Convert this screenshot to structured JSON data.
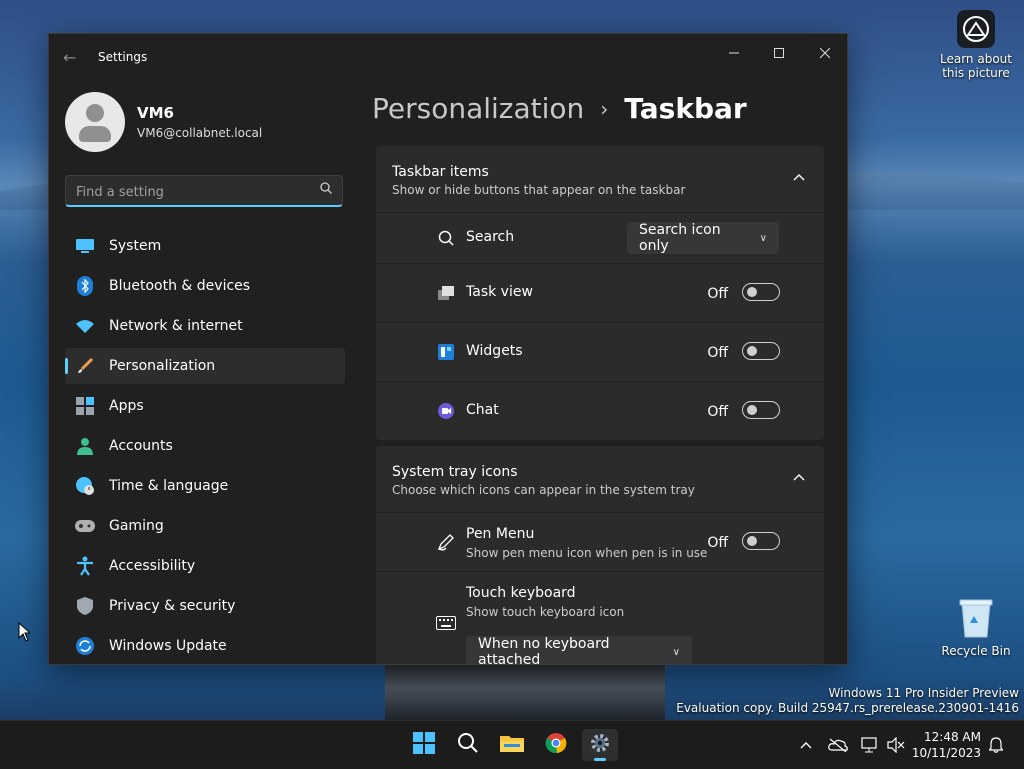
{
  "desktop": {
    "learn_label": "Learn about this picture",
    "recycle_label": "Recycle Bin",
    "watermark_line1": "Windows 11 Pro Insider Preview",
    "watermark_line2": "Evaluation copy. Build 25947.rs_prerelease.230901-1416"
  },
  "window": {
    "title": "Settings",
    "minimize_icon": "minimize-icon",
    "maximize_icon": "maximize-icon",
    "close_icon": "close-icon"
  },
  "profile": {
    "name": "VM6",
    "email": "VM6@collabnet.local"
  },
  "search": {
    "placeholder": "Find a setting",
    "value": ""
  },
  "sidebar": {
    "items": [
      {
        "label": "System",
        "icon": "monitor-icon"
      },
      {
        "label": "Bluetooth & devices",
        "icon": "bluetooth-icon"
      },
      {
        "label": "Network & internet",
        "icon": "wifi-icon"
      },
      {
        "label": "Personalization",
        "icon": "brush-icon",
        "active": true
      },
      {
        "label": "Apps",
        "icon": "apps-icon"
      },
      {
        "label": "Accounts",
        "icon": "person-icon"
      },
      {
        "label": "Time & language",
        "icon": "globe-clock-icon"
      },
      {
        "label": "Gaming",
        "icon": "gamepad-icon"
      },
      {
        "label": "Accessibility",
        "icon": "accessibility-icon"
      },
      {
        "label": "Privacy & security",
        "icon": "shield-icon"
      },
      {
        "label": "Windows Update",
        "icon": "update-icon"
      }
    ]
  },
  "breadcrumb": {
    "parent": "Personalization",
    "separator": "›",
    "current": "Taskbar"
  },
  "taskbar_items": {
    "title": "Taskbar items",
    "subtitle": "Show or hide buttons that appear on the taskbar",
    "search": {
      "label": "Search",
      "value": "Search icon only"
    },
    "task_view": {
      "label": "Task view",
      "state": "Off"
    },
    "widgets": {
      "label": "Widgets",
      "state": "Off"
    },
    "chat": {
      "label": "Chat",
      "state": "Off"
    }
  },
  "system_tray": {
    "title": "System tray icons",
    "subtitle": "Choose which icons can appear in the system tray",
    "pen_menu": {
      "label": "Pen Menu",
      "sub": "Show pen menu icon when pen is in use",
      "state": "Off"
    },
    "touch_keyboard": {
      "label": "Touch keyboard",
      "sub": "Show touch keyboard icon",
      "value": "When no keyboard attached"
    }
  },
  "taskbar": {
    "time": "12:48 AM",
    "date": "10/11/2023"
  },
  "colors": {
    "accent": "#60cdff",
    "window_bg": "#202020",
    "card_bg": "#2b2b2b"
  }
}
